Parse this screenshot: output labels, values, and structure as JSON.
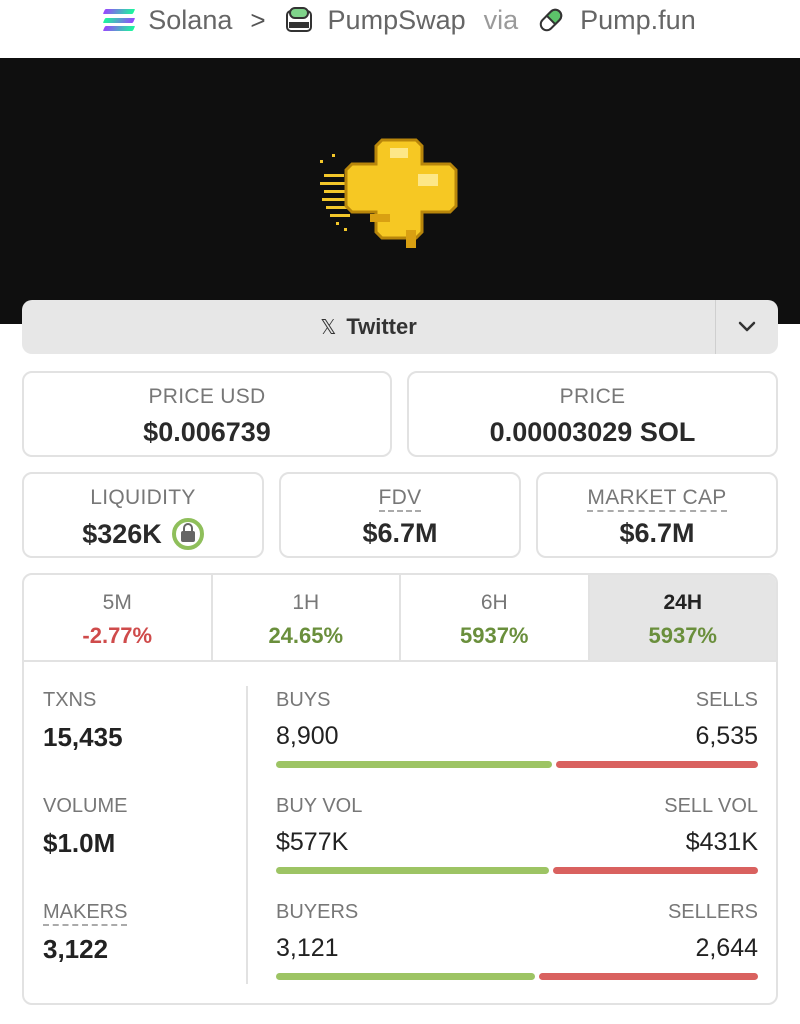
{
  "breadcrumb": {
    "chain": "Solana",
    "separator": ">",
    "dex": "PumpSwap",
    "via": "via",
    "source": "Pump.fun"
  },
  "social": {
    "twitter_label": "Twitter",
    "x_glyph": "𝕏"
  },
  "prices": {
    "price_usd_label": "PRICE USD",
    "price_usd": "$0.006739",
    "price_label": "PRICE",
    "price_sol": "0.00003029 SOL"
  },
  "metrics": {
    "liquidity_label": "LIQUIDITY",
    "liquidity": "$326K",
    "fdv_label": "FDV",
    "fdv": "$6.7M",
    "mcap_label": "MARKET CAP",
    "mcap": "$6.7M"
  },
  "periods": [
    {
      "label": "5M",
      "change": "-2.77%",
      "direction": "negative"
    },
    {
      "label": "1H",
      "change": "24.65%",
      "direction": "positive"
    },
    {
      "label": "6H",
      "change": "5937%",
      "direction": "positive"
    },
    {
      "label": "24H",
      "change": "5937%",
      "direction": "positive",
      "active": true
    }
  ],
  "stats": {
    "txns_label": "TXNS",
    "txns": "15,435",
    "volume_label": "VOLUME",
    "volume": "$1.0M",
    "makers_label": "MAKERS",
    "makers": "3,122",
    "buys_label": "BUYS",
    "buys": "8,900",
    "sells_label": "SELLS",
    "sells": "6,535",
    "buy_vol_label": "BUY VOL",
    "buy_vol": "$577K",
    "sell_vol_label": "SELL VOL",
    "sell_vol": "$431K",
    "buyers_label": "BUYERS",
    "buyers": "3,121",
    "sellers_label": "SELLERS",
    "sellers": "2,644",
    "buy_share_txns": 0.577,
    "buy_share_volume": 0.572,
    "buy_share_makers": 0.541
  },
  "colors": {
    "positive": "#6a8f3c",
    "negative": "#cf4b4b",
    "buy_bar": "#9dc464",
    "sell_bar": "#d9615f"
  }
}
